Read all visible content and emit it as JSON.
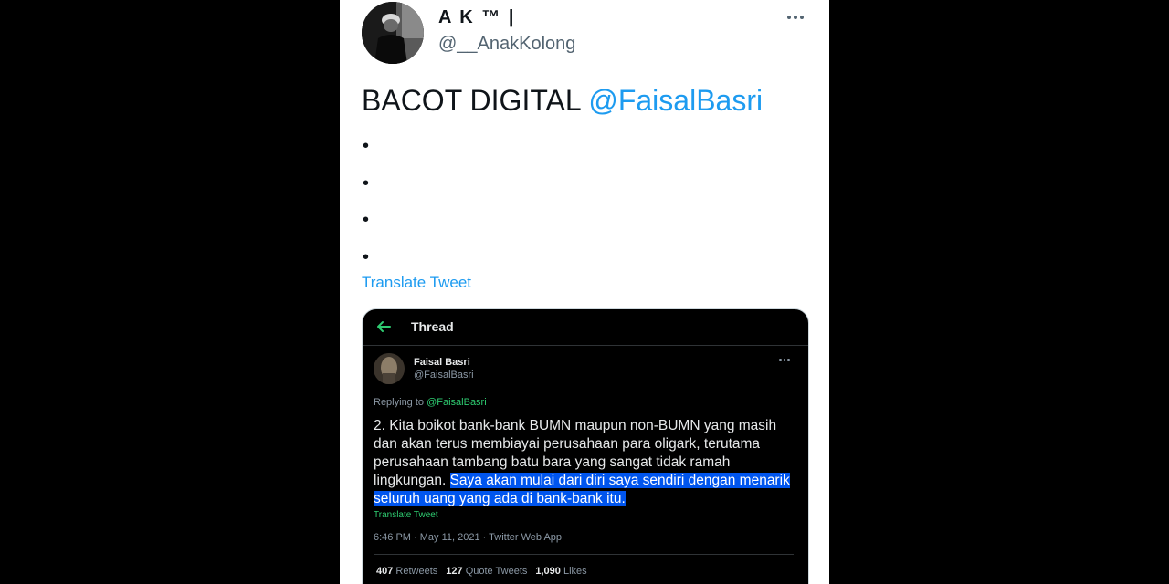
{
  "author": {
    "display_name": "A K ™ |",
    "handle": "@__AnakKolong"
  },
  "tweet": {
    "text": "BACOT DIGITAL ",
    "mention": "@FaisalBasri",
    "bullets": [
      "•",
      "•",
      "•",
      "•"
    ],
    "translate_label": "Translate Tweet"
  },
  "embedded": {
    "header_title": "Thread",
    "author_name": "Faisal Basri",
    "author_handle": "@FaisalBasri",
    "replying_prefix": "Replying to ",
    "replying_to": "@FaisalBasri",
    "text_plain": "2. Kita boikot bank-bank BUMN maupun non-BUMN yang masih dan akan terus membiayai perusahaan para oligark, terutama perusahaan tambang batu bara yang sangat tidak ramah lingkungan. ",
    "text_highlighted": "Saya akan mulai dari diri saya sendiri dengan menarik seluruh uang yang ada di bank-bank itu.",
    "translate_label": "Translate Tweet",
    "timestamp": "6:46 PM · May 11, 2021 · Twitter Web App",
    "retweets_count": "407",
    "retweets_label": "Retweets",
    "quotes_count": "127",
    "quotes_label": "Quote Tweets",
    "likes_count": "1,090",
    "likes_label": "Likes"
  },
  "colors": {
    "accent": "#1d9bf0",
    "embed_accent": "#2ecc71",
    "highlight": "#0055ee"
  }
}
